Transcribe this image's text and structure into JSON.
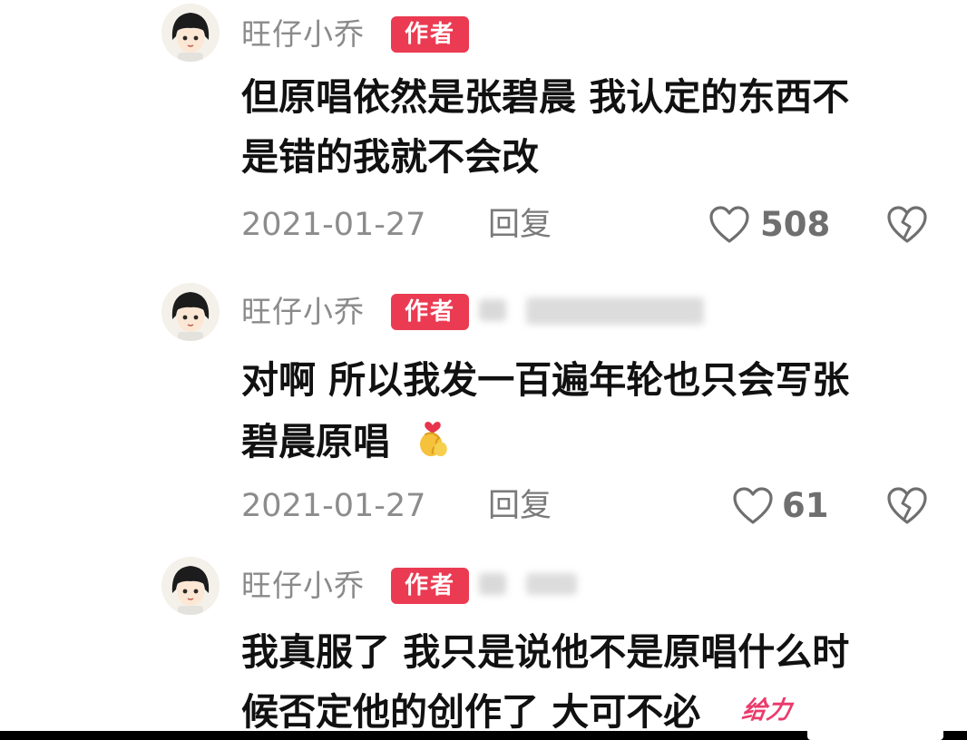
{
  "author_badge_label": "作者",
  "colors": {
    "badge": "#ea3b52",
    "username": "#8a8a8a",
    "body_text": "#111111",
    "meta_text": "#8c8c8c"
  },
  "comments": [
    {
      "username": "旺仔小乔",
      "badge": "作者",
      "body_lines": [
        "但原唱依然是张碧晨 我认定的东西不",
        "是错的我就不会改"
      ],
      "date": "2021-01-27",
      "reply_label": "回复",
      "likes": "508",
      "like_icon": "heart-outline-icon",
      "dislike_icon": "broken-heart-icon"
    },
    {
      "username": "旺仔小乔",
      "badge": "作者",
      "body_lines": [
        "对啊 所以我发一百遍年轮也只会写张",
        "碧晨原唱"
      ],
      "sticker": "hands-heart-emoji",
      "date": "2021-01-27",
      "reply_label": "回复",
      "likes": "61",
      "like_icon": "heart-outline-icon",
      "dislike_icon": "broken-heart-icon"
    },
    {
      "username": "旺仔小乔",
      "badge": "作者",
      "body_lines": [
        "我真服了 我只是说他不是原唱什么时",
        "候否定他的创作了 大可不必"
      ],
      "sticker_text": "给力"
    }
  ]
}
